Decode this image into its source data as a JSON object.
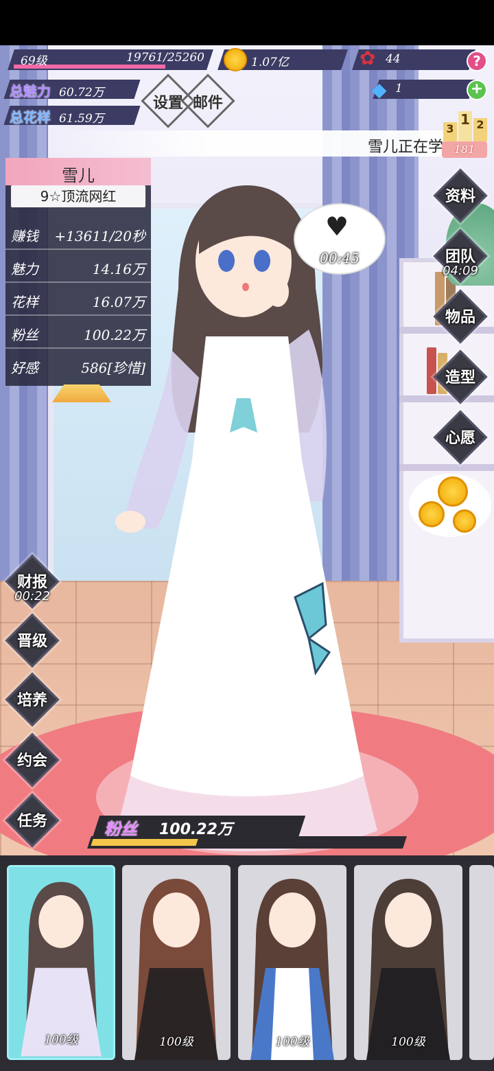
{
  "player": {
    "level": "69级",
    "exp": "19761/25260",
    "exp_fraction": 0.782,
    "total_charm_label": "总魅力",
    "total_charm_value": "60.72万",
    "total_flower_label": "总花样",
    "total_flower_value": "61.59万"
  },
  "currency": {
    "coins": "1.07亿",
    "roses": "44",
    "diamonds": "1"
  },
  "menu": {
    "settings": "设置",
    "mail": "邮件"
  },
  "ticker": {
    "text": "雪儿正在学",
    "rank_badge": "181",
    "podium": [
      "3",
      "1",
      "2"
    ]
  },
  "character": {
    "name": "雪儿",
    "title": "9☆顶流网红",
    "stats": [
      {
        "label": "赚钱",
        "value": "+13611/20秒"
      },
      {
        "label": "魅力",
        "value": "14.16万"
      },
      {
        "label": "花样",
        "value": "16.07万"
      },
      {
        "label": "粉丝",
        "value": "100.22万"
      },
      {
        "label": "好感",
        "value": "586[珍惜]"
      }
    ],
    "heart_timer": "00:45"
  },
  "right_buttons": [
    {
      "label": "资料",
      "sub": ""
    },
    {
      "label": "团队",
      "sub": "04:09"
    },
    {
      "label": "物品",
      "sub": ""
    },
    {
      "label": "造型",
      "sub": ""
    },
    {
      "label": "心愿",
      "sub": ""
    }
  ],
  "left_buttons": [
    {
      "label": "财报",
      "sub": "00:22"
    },
    {
      "label": "晋级",
      "sub": ""
    },
    {
      "label": "培养",
      "sub": ""
    },
    {
      "label": "约会",
      "sub": ""
    },
    {
      "label": "任务",
      "sub": ""
    }
  ],
  "fans": {
    "label": "粉丝",
    "value": "100.22万",
    "progress_fraction": 0.34
  },
  "roster": [
    {
      "level": "100级"
    },
    {
      "level": "100级"
    },
    {
      "level": "100级"
    },
    {
      "level": "100级"
    }
  ],
  "colors": {
    "exp_fill": "#f06aa6",
    "selected_card": "#7fe0e6",
    "fans_fill": "#f4c64a",
    "help_button": "#e24f86",
    "plus_button": "#5cc24e"
  }
}
